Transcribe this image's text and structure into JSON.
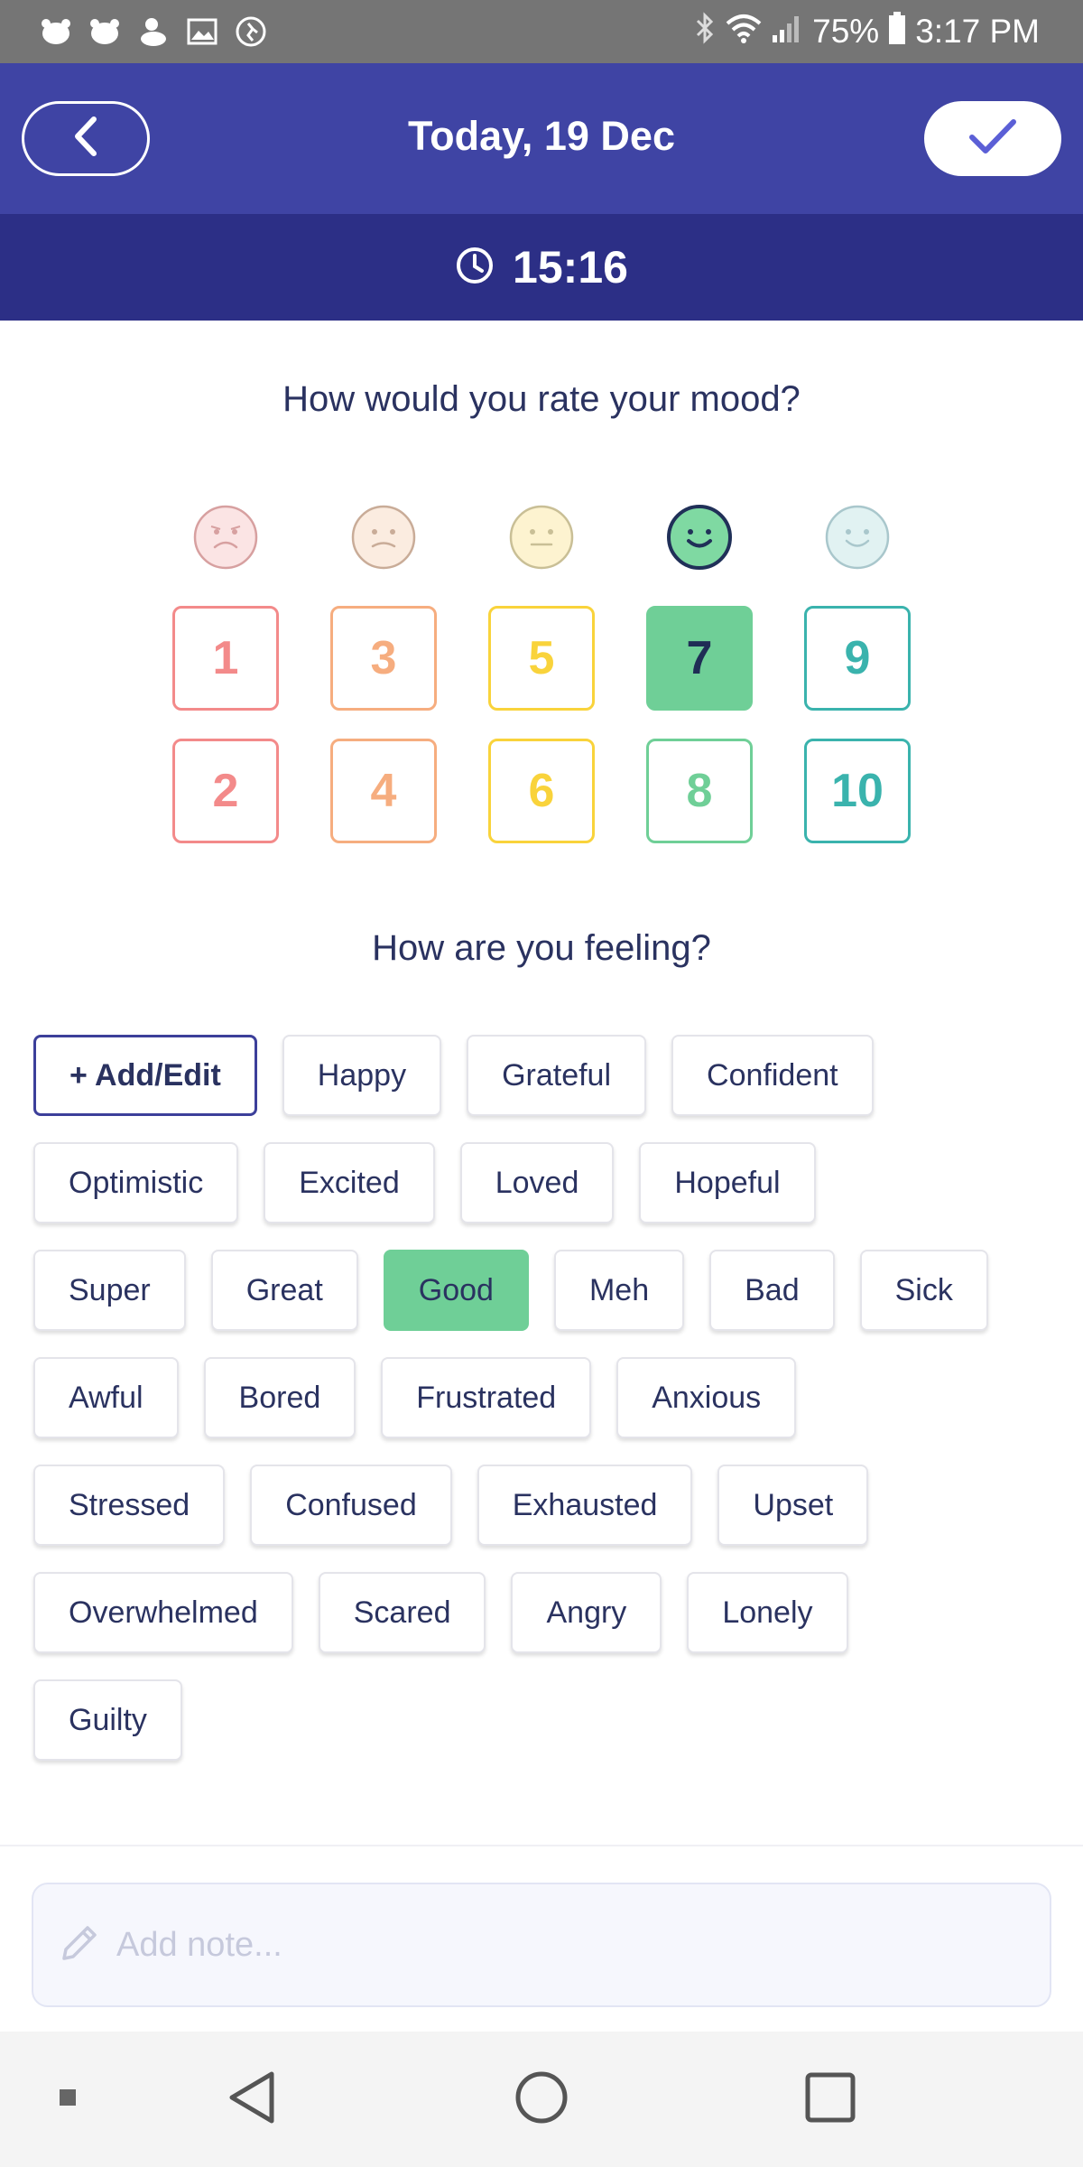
{
  "status_bar": {
    "battery": "75%",
    "time": "3:17 PM"
  },
  "header": {
    "title": "Today, 19 Dec",
    "time": "15:16"
  },
  "mood": {
    "question": "How would you rate your mood?",
    "selected": "7",
    "columns": [
      {
        "face": "very-sad-face-icon",
        "color": "#f38a8a",
        "values": [
          "1",
          "2"
        ]
      },
      {
        "face": "sad-face-icon",
        "color": "#f6ad7f",
        "values": [
          "3",
          "4"
        ]
      },
      {
        "face": "neutral-face-icon",
        "color": "#f9d33b",
        "values": [
          "5",
          "6"
        ]
      },
      {
        "face": "smiling-face-icon",
        "color": "#6fcf97",
        "values": [
          "7",
          "8"
        ]
      },
      {
        "face": "happy-face-icon",
        "color": "#3ab3ad",
        "values": [
          "9",
          "10"
        ]
      }
    ]
  },
  "feelings": {
    "question": "How are you feeling?",
    "add_label": "+ Add/Edit",
    "selected": "Good",
    "rows": [
      [
        "Happy",
        "Grateful",
        "Confident"
      ],
      [
        "Optimistic",
        "Excited",
        "Loved",
        "Hopeful"
      ],
      [
        "Super",
        "Great",
        "Good",
        "Meh",
        "Bad",
        "Sick"
      ],
      [
        "Awful",
        "Bored",
        "Frustrated",
        "Anxious"
      ],
      [
        "Stressed",
        "Confused",
        "Exhausted",
        "Upset"
      ],
      [
        "Overwhelmed",
        "Scared",
        "Angry",
        "Lonely"
      ],
      [
        "Guilty"
      ]
    ]
  },
  "note": {
    "placeholder": "Add note..."
  },
  "colors": {
    "header": "#3f44a4",
    "time_bar": "#2c2f86",
    "accent_green": "#6fcf97",
    "text": "#2a3260"
  }
}
